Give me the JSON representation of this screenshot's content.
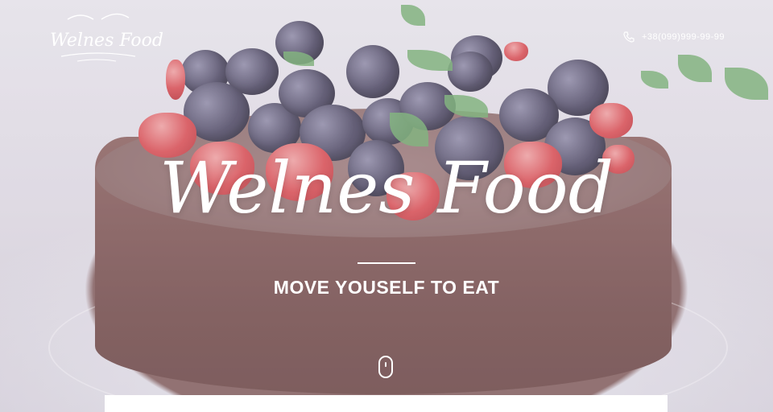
{
  "brand": {
    "logo_text": "Welnes Food"
  },
  "header": {
    "phone": "+38(099)999-99-99",
    "phone_icon": "phone-icon"
  },
  "hero": {
    "title": "Welnes Food",
    "subtitle": "MOVE YOUSELF TO EAT",
    "scroll_icon": "mouse-scroll-icon"
  },
  "colors": {
    "text": "#ffffff",
    "cake": "#7c5250",
    "berry": "#4a4560",
    "strawberry": "#d94a4f",
    "leaf": "#6faa6a"
  }
}
